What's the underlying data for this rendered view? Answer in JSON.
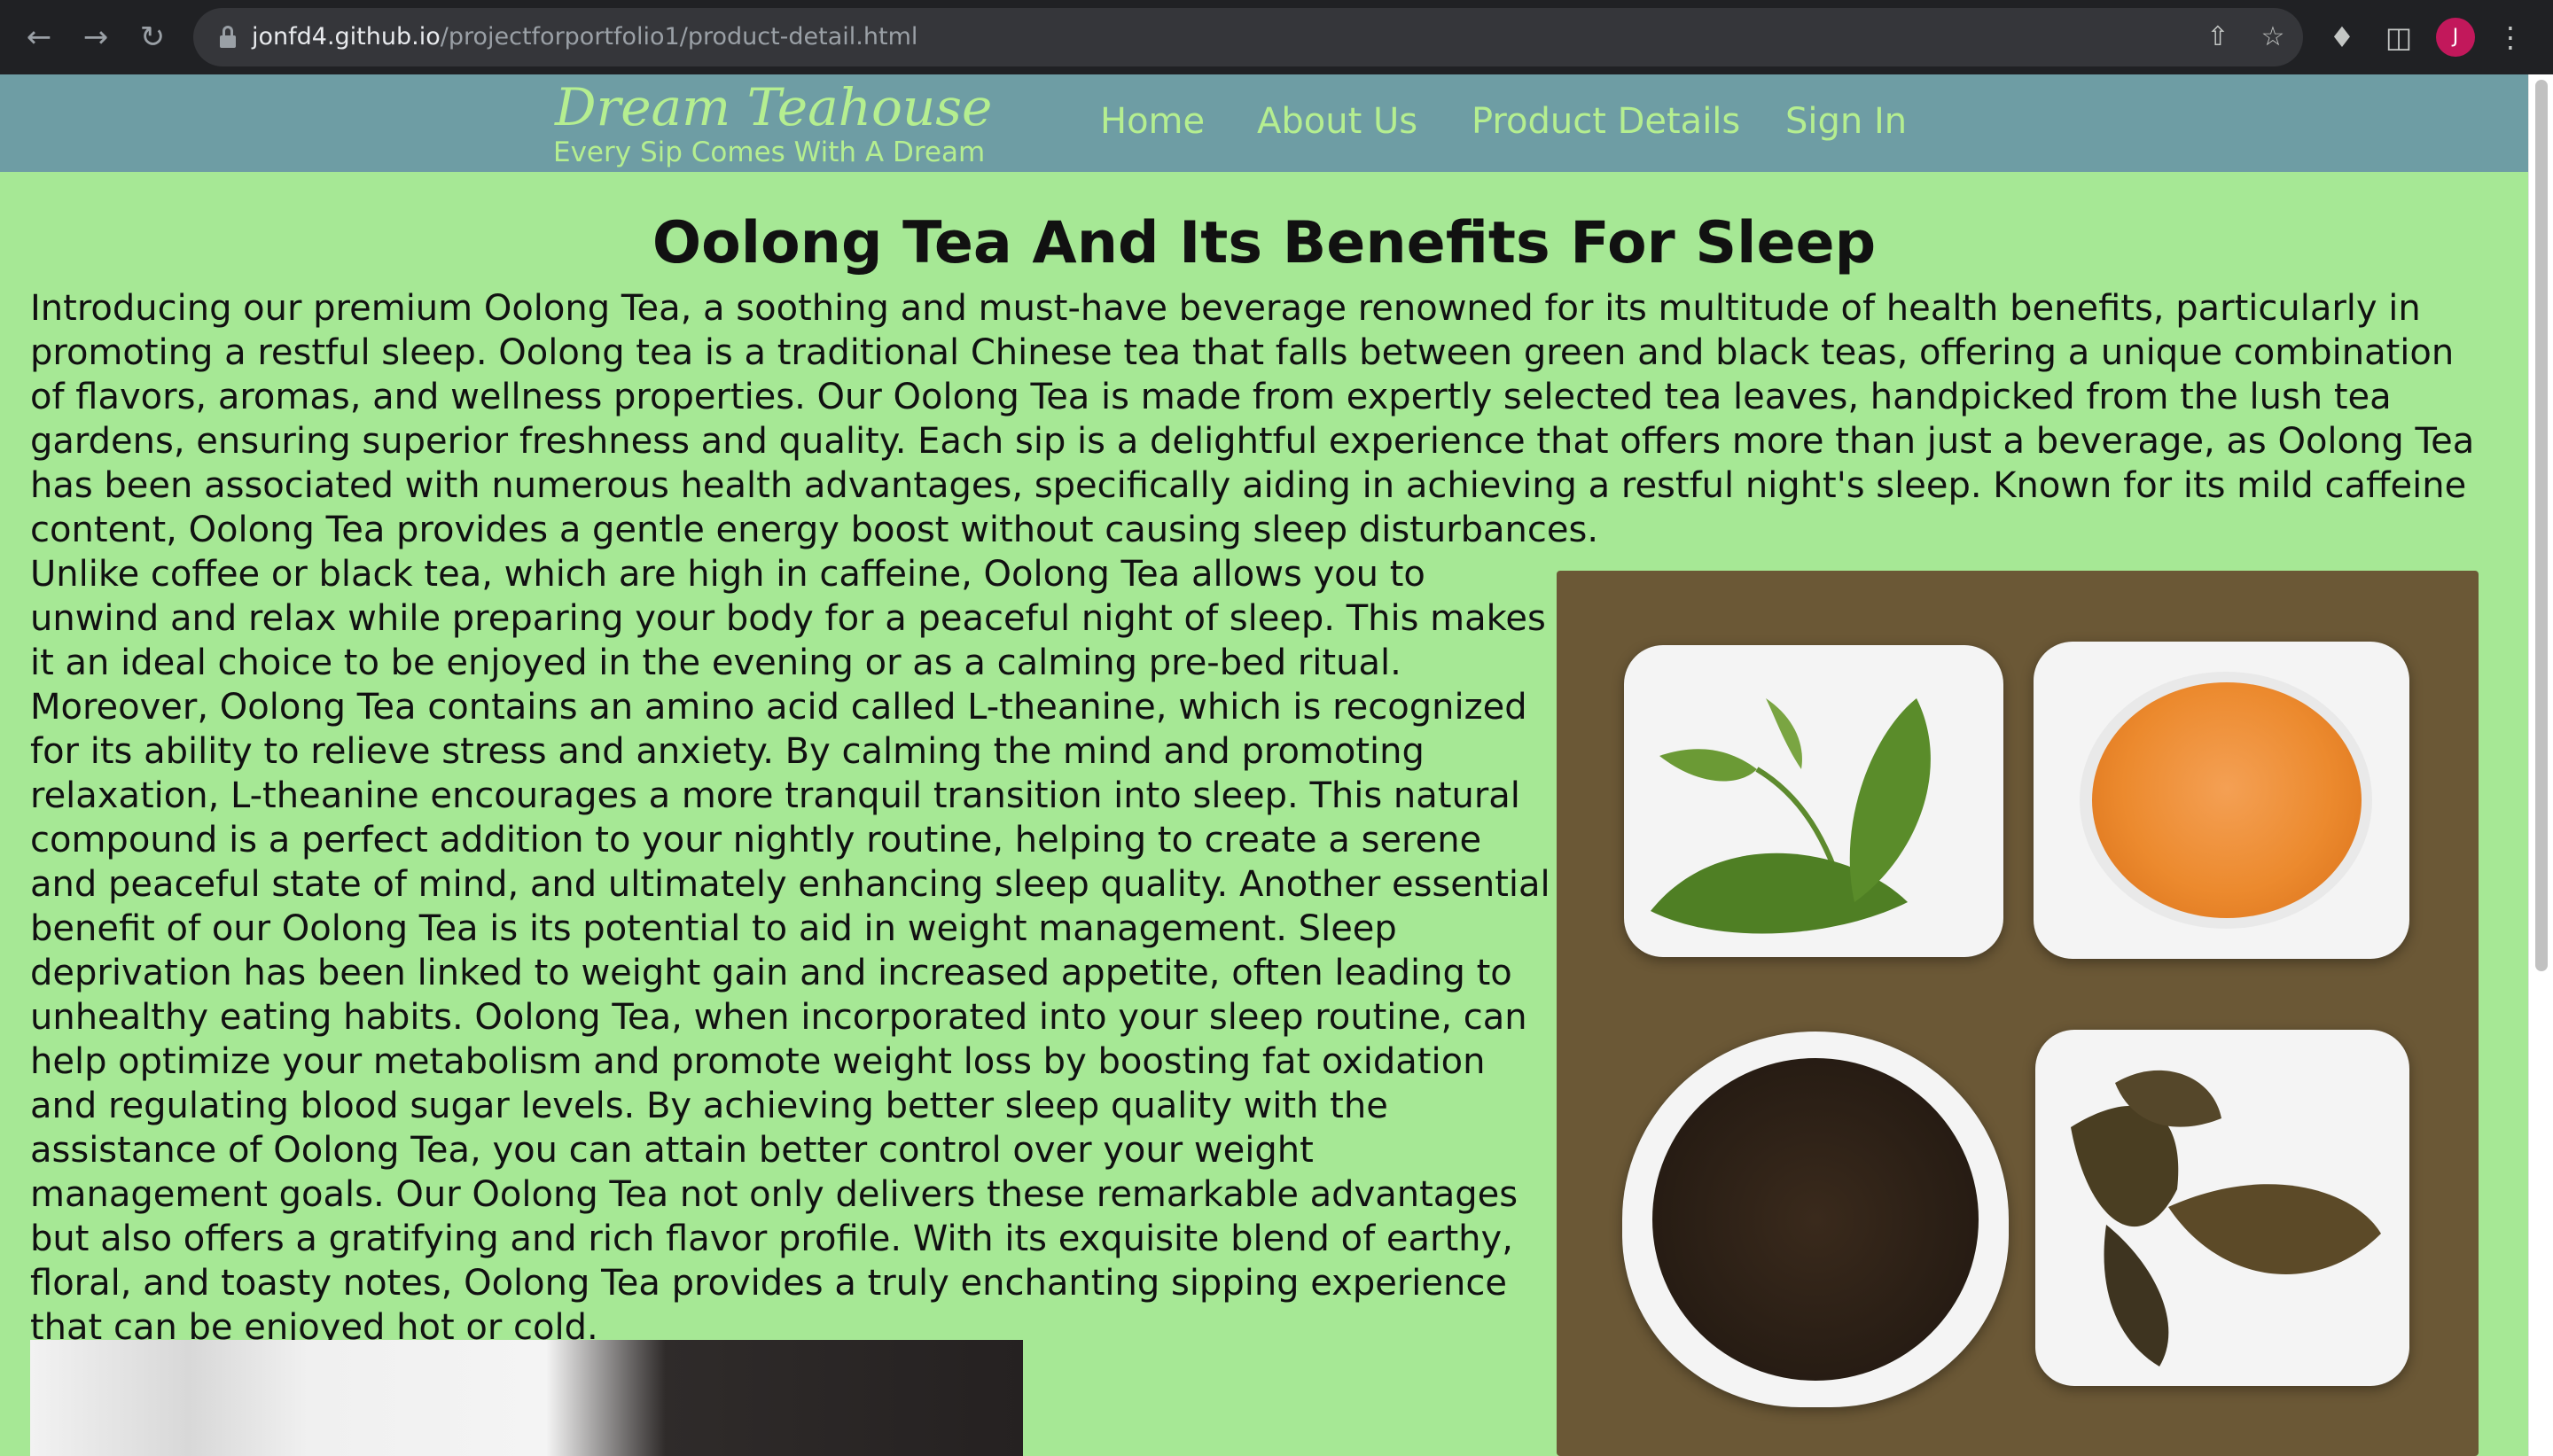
{
  "browser": {
    "url_host": "jonfd4.github.io",
    "url_path": "/projectforportfolio1/product-detail.html",
    "profile_initial": "J",
    "icons": [
      "back-arrow-icon",
      "forward-arrow-icon",
      "reload-icon",
      "lock-icon",
      "share-icon",
      "star-icon",
      "extensions-icon",
      "side-panel-icon",
      "menu-icon"
    ]
  },
  "site": {
    "brand": "Dream Teahouse",
    "tagline": "Every Sip Comes With A Dream",
    "nav": [
      "Home",
      "About Us",
      "Product Details",
      "Sign In"
    ]
  },
  "main": {
    "title": "Oolong Tea And Its Benefits For Sleep",
    "paragraphs": [
      "Introducing our premium Oolong Tea, a soothing and must-have beverage renowned for its multitude of health benefits, particularly in promoting a restful sleep. Oolong tea is a traditional Chinese tea that falls between green and black teas, offering a unique combination of flavors, aromas, and wellness properties. Our Oolong Tea is made from expertly selected tea leaves, handpicked from the lush tea gardens, ensuring superior freshness and quality. Each sip is a delightful experience that offers more than just a beverage, as Oolong Tea has been associated with numerous health advantages, specifically aiding in achieving a restful night's sleep. Known for its mild caffeine content, Oolong Tea provides a gentle energy boost without causing sleep disturbances.",
      "Unlike coffee or black tea, which are high in caffeine, Oolong Tea allows you to unwind and relax while preparing your body for a peaceful night of sleep. This makes it an ideal choice to be enjoyed in the evening or as a calming pre-bed ritual. Moreover, Oolong Tea contains an amino acid called L-theanine, which is recognized for its ability to relieve stress and anxiety. By calming the mind and promoting relaxation, L-theanine encourages a more tranquil transition into sleep. This natural compound is a perfect addition to your nightly routine, helping to create a serene and peaceful state of mind, and ultimately enhancing sleep quality. Another essential benefit of our Oolong Tea is its potential to aid in weight management. Sleep deprivation has been linked to weight gain and increased appetite, often leading to unhealthy eating habits. Oolong Tea, when incorporated into your sleep routine, can help optimize your metabolism and promote weight loss by boosting fat oxidation and regulating blood sugar levels. By achieving better sleep quality with the assistance of Oolong Tea, you can attain better control over your weight management goals. Our Oolong Tea not only delivers these remarkable advantages but also offers a gratifying and rich flavor profile. With its exquisite blend of earthy, floral, and toasty notes, Oolong Tea provides a truly enchanting sipping experience that can be enjoyed hot or cold."
    ]
  },
  "colors": {
    "page_background": "#a6e895",
    "header_background": "#6e9da4",
    "header_text": "#b5ee90",
    "chrome_background": "#202124",
    "profile_avatar": "#c2185b"
  }
}
